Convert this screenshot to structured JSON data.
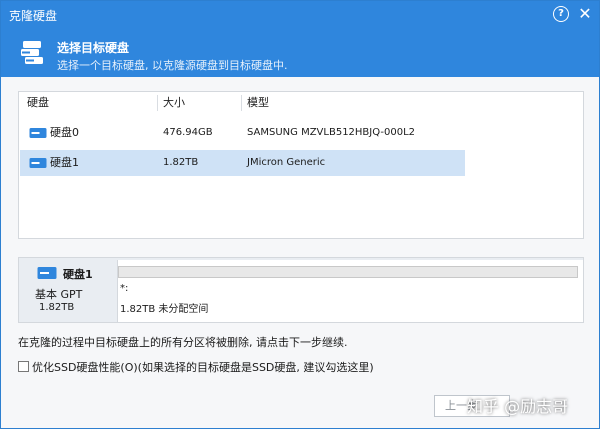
{
  "window": {
    "title": "克隆硬盘",
    "help_glyph": "?",
    "close_glyph": "✕"
  },
  "header": {
    "title": "选择目标硬盘",
    "subtitle": "选择一个目标硬盘, 以克隆源硬盘到目标硬盘中."
  },
  "disk_table": {
    "columns": [
      "硬盘",
      "大小",
      "模型"
    ],
    "rows": [
      {
        "name": "硬盘0",
        "size": "476.94GB",
        "model": "SAMSUNG MZVLB512HBJQ-000L2",
        "selected": false
      },
      {
        "name": "硬盘1",
        "size": "1.82TB",
        "model": "JMicron Generic",
        "selected": true
      }
    ]
  },
  "selected_disk": {
    "name": "硬盘1",
    "type": "基本 GPT",
    "size": "1.82TB",
    "partition_label": "*:",
    "partition_desc": "1.82TB 未分配空间"
  },
  "warning_text": "在克隆的过程中目标硬盘上的所有分区将被删除, 请点击下一步继续.",
  "optimize_ssd": {
    "label": "优化SSD硬盘性能(O)(如果选择的目标硬盘是SSD硬盘, 建议勾选这里)",
    "checked": false
  },
  "footer": {
    "back_label": "上一步",
    "watermark": "知乎 @励志哥"
  },
  "colors": {
    "accent": "#2f86dd",
    "selected_row": "#cfe2f6"
  }
}
